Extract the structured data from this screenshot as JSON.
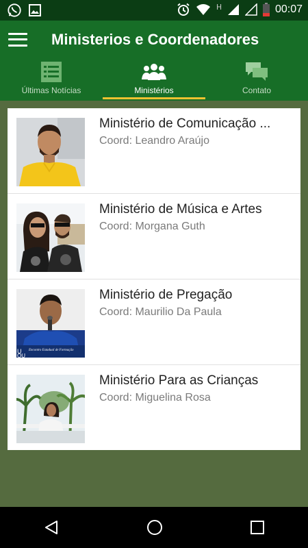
{
  "status": {
    "time": "00:07",
    "network_label": "H"
  },
  "appbar": {
    "title": "Ministerios e Coordenadores"
  },
  "tabs": [
    {
      "label": "Últimas Notícias",
      "icon": "news-icon"
    },
    {
      "label": "Ministérios",
      "icon": "people-icon"
    },
    {
      "label": "Contato",
      "icon": "chat-icon"
    }
  ],
  "ministries": [
    {
      "name": "Ministério de Comunicação ...",
      "coord": "Coord: Leandro Araújo",
      "photo": "photo-leandro"
    },
    {
      "name": "Ministério de Música e Artes",
      "coord": "Coord: Morgana Guth",
      "photo": "photo-morgana"
    },
    {
      "name": "Ministério de Pregação",
      "coord": "Coord: Maurilio Da Paula",
      "photo": "photo-maurilio"
    },
    {
      "name": "Ministério Para as Crianças",
      "coord": "Coord: Miguelina Rosa",
      "photo": "photo-miguelina"
    }
  ],
  "photo_caption": "Encontro Estadual de Formação",
  "colors": {
    "appbar": "#176e27",
    "statusbar": "#0b3d14",
    "background": "#556b3f",
    "tab_indicator": "#f2c230"
  }
}
